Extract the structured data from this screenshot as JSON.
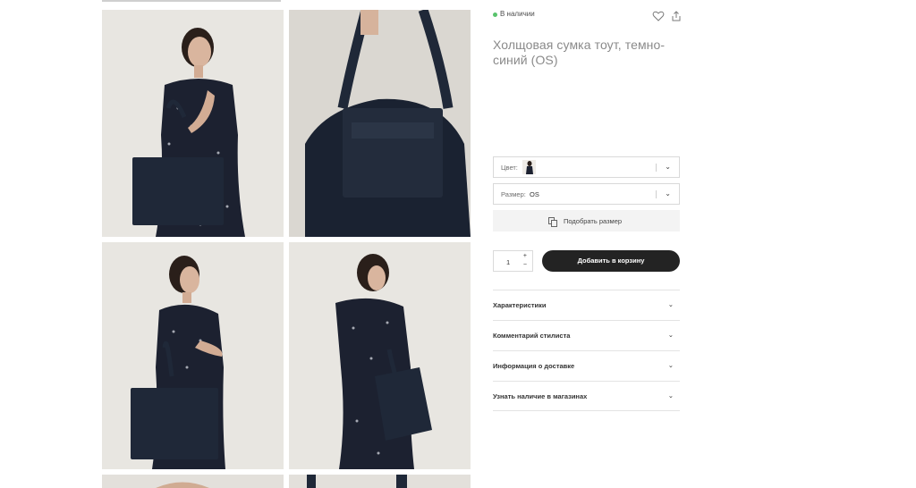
{
  "product": {
    "stock_status": "В наличии",
    "title": "Холщовая сумка тоут, темно-синий (OS)"
  },
  "options": {
    "color_label": "Цвет:",
    "size_label": "Размер:",
    "size_value": "OS",
    "size_guide": "Подобрать размер"
  },
  "cart": {
    "quantity": "1",
    "plus": "+",
    "minus": "−",
    "add_to_cart": "Добавить в корзину"
  },
  "accordion": [
    {
      "label": "Характеристики"
    },
    {
      "label": "Комментарий стилиста"
    },
    {
      "label": "Информация о доставке"
    },
    {
      "label": "Узнать наличие в магазинах"
    }
  ],
  "icons": {
    "favorite": "heart-icon",
    "share": "share-icon",
    "chevron": "chevron-down-icon",
    "size_guide": "size-guide-icon"
  },
  "colors": {
    "accent_dark": "#232323",
    "in_stock": "#58c36c",
    "bag": "#1f2838"
  }
}
